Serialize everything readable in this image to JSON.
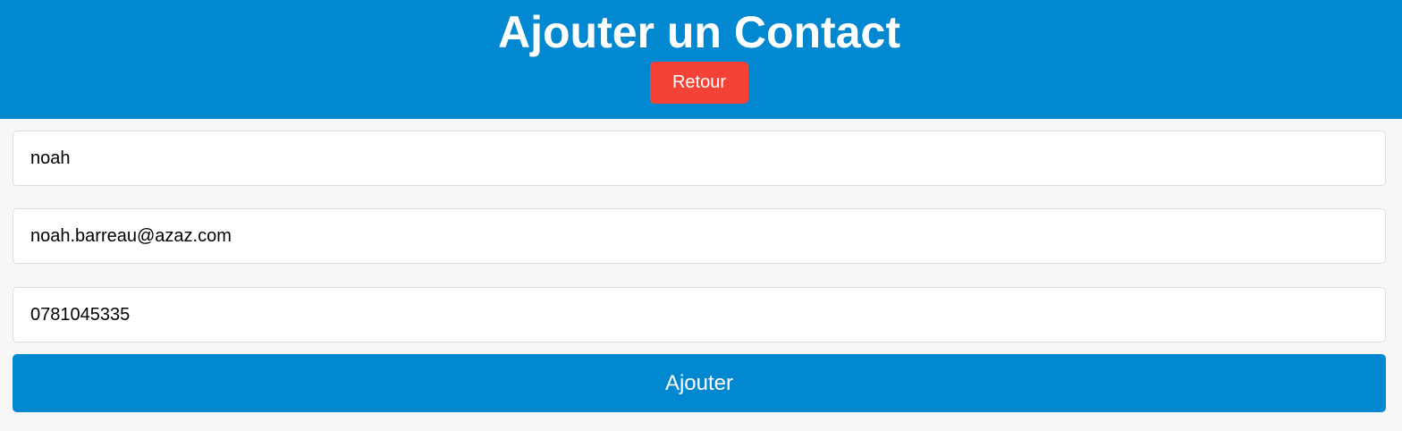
{
  "header": {
    "title": "Ajouter un Contact",
    "back_label": "Retour"
  },
  "form": {
    "name_value": "noah",
    "email_value": "noah.barreau@azaz.com",
    "phone_value": "0781045335",
    "submit_label": "Ajouter"
  },
  "colors": {
    "header_bg": "#0288d1",
    "back_button_bg": "#f44336",
    "submit_button_bg": "#0288d1",
    "page_bg": "#f7f7f7"
  }
}
